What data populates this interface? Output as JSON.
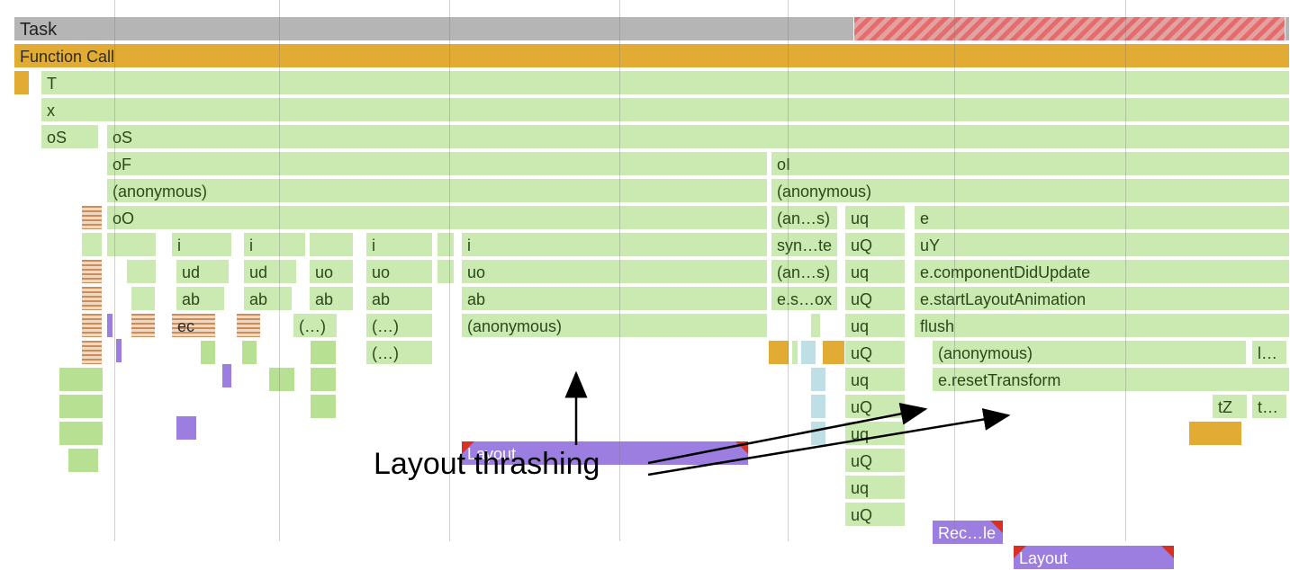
{
  "labels": {
    "task": "Task",
    "function_call": "Function Call",
    "T": "T",
    "x": "x",
    "oS": "oS",
    "oF": "oF",
    "anonymous": "(anonymous)",
    "oO": "oO",
    "i": "i",
    "ud": "ud",
    "uo": "uo",
    "ab": "ab",
    "ec": "ec",
    "paren": "(…)",
    "layout": "Layout",
    "oI": "oI",
    "an_s": "(an…s)",
    "syn_te": "syn…te",
    "es_ox": "e.s…ox",
    "uq": "uq",
    "uQ": "uQ",
    "uY": "uY",
    "e": "e",
    "componentDidUpdate": "e.componentDidUpdate",
    "startLayoutAnimation": "e.startLayoutAnimation",
    "flush": "flush",
    "resetTransform": "e.resetTransform",
    "rec_le": "Rec…le",
    "tZ": "tZ",
    "t_trunc": "t…",
    "l_trunc": "l…"
  },
  "annotation": "Layout thrashing",
  "colors": {
    "task": "#b5b5b5",
    "scripting": "#e2ab34",
    "js": "#cbeab1",
    "layout": "#9c7ee0",
    "paint": "#bedfe5",
    "warning": "#d93025"
  }
}
